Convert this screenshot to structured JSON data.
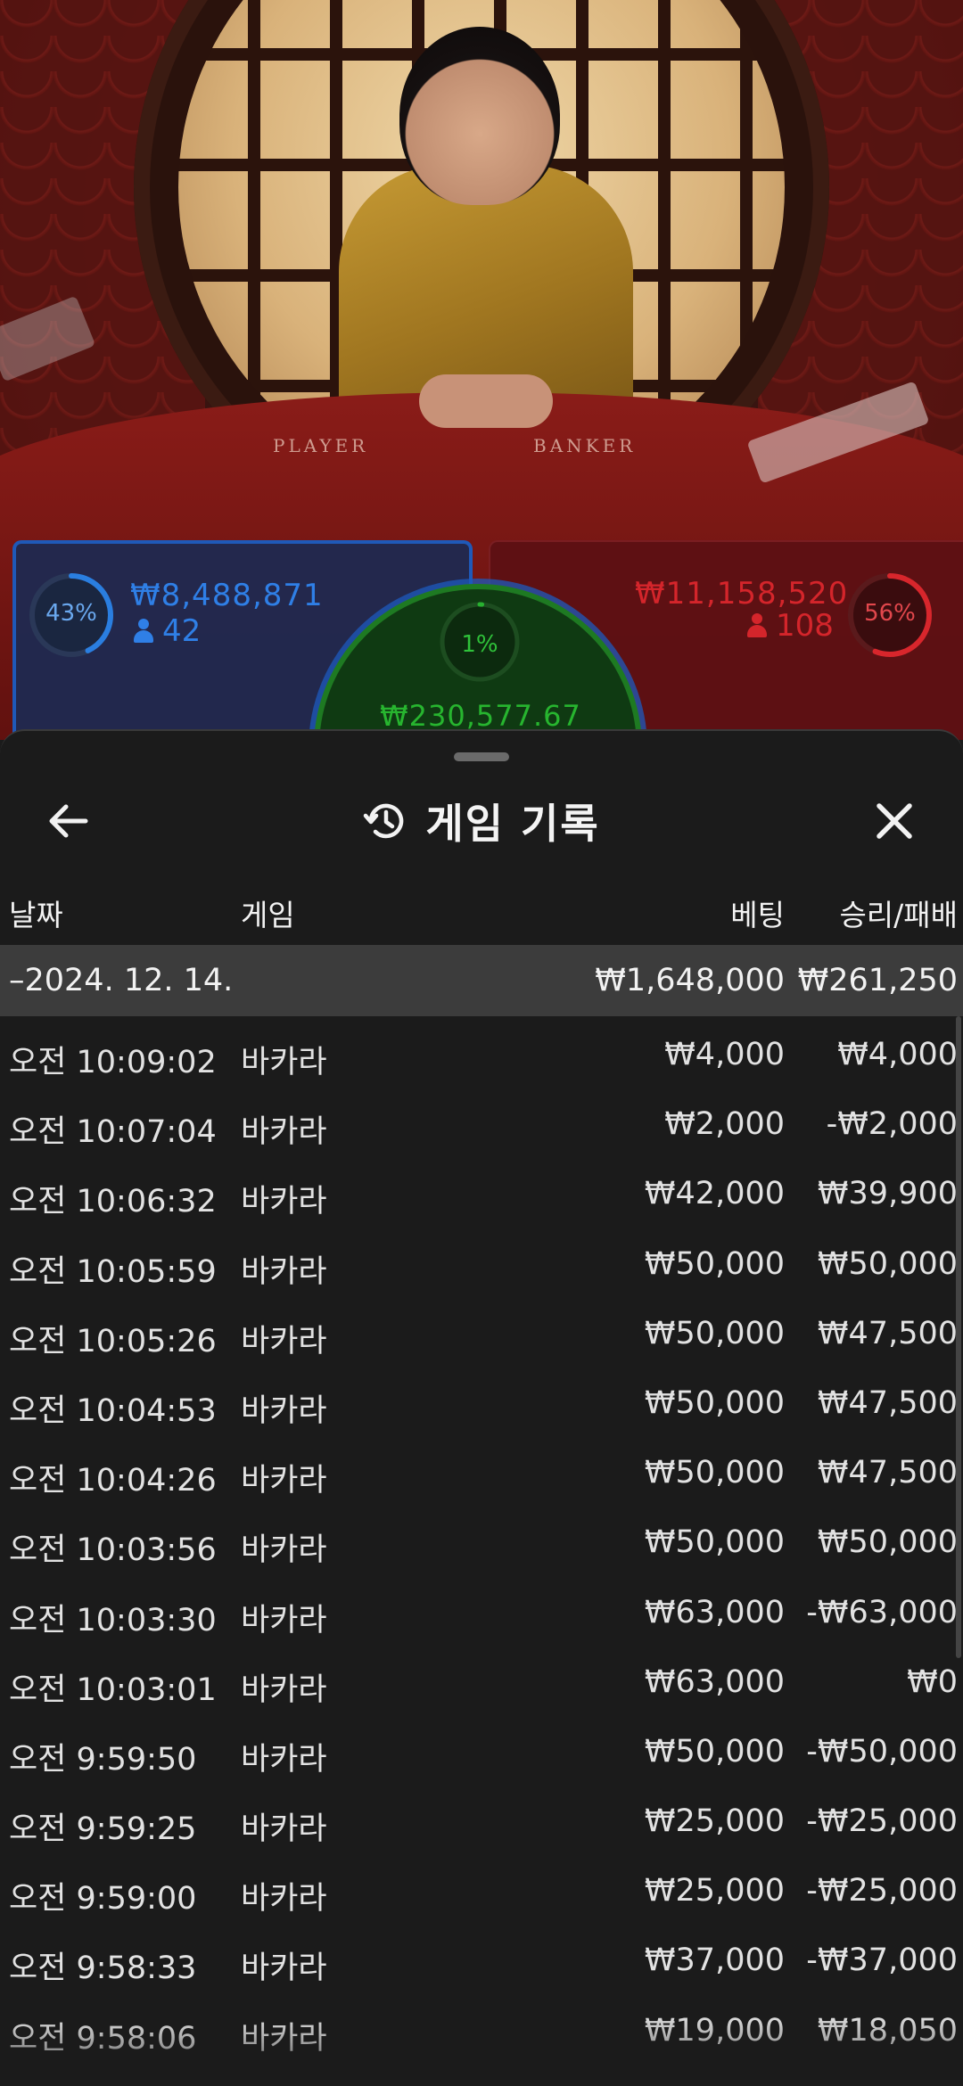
{
  "table": {
    "player_label": "PLAYER",
    "banker_label": "BANKER"
  },
  "stats": {
    "player": {
      "percent_text": "43%",
      "percent": 43,
      "amount": "₩8,488,871",
      "users": "42",
      "color": "#2a7ee0"
    },
    "tie": {
      "percent_text": "1%",
      "percent": 1,
      "amount": "₩230,577.67",
      "color": "#28b030"
    },
    "banker": {
      "percent_text": "56%",
      "percent": 56,
      "amount": "₩11,158,520",
      "users": "108",
      "color": "#d8262c"
    }
  },
  "sheet": {
    "title": "게임 기록",
    "back_icon": "arrow-left-icon",
    "history_icon": "history-icon",
    "close_icon": "close-icon",
    "columns": {
      "date": "날짜",
      "game": "게임",
      "bet": "베팅",
      "result": "승리/패배"
    },
    "day": {
      "date": "–2024. 12. 14.",
      "total_bet": "₩1,648,000",
      "total_result": "₩261,250"
    },
    "rows": [
      {
        "time": "오전 10:09:02",
        "game": "바카라",
        "bet": "₩4,000",
        "result": "₩4,000"
      },
      {
        "time": "오전 10:07:04",
        "game": "바카라",
        "bet": "₩2,000",
        "result": "-₩2,000"
      },
      {
        "time": "오전 10:06:32",
        "game": "바카라",
        "bet": "₩42,000",
        "result": "₩39,900"
      },
      {
        "time": "오전 10:05:59",
        "game": "바카라",
        "bet": "₩50,000",
        "result": "₩50,000"
      },
      {
        "time": "오전 10:05:26",
        "game": "바카라",
        "bet": "₩50,000",
        "result": "₩47,500"
      },
      {
        "time": "오전 10:04:53",
        "game": "바카라",
        "bet": "₩50,000",
        "result": "₩47,500"
      },
      {
        "time": "오전 10:04:26",
        "game": "바카라",
        "bet": "₩50,000",
        "result": "₩47,500"
      },
      {
        "time": "오전 10:03:56",
        "game": "바카라",
        "bet": "₩50,000",
        "result": "₩50,000"
      },
      {
        "time": "오전 10:03:30",
        "game": "바카라",
        "bet": "₩63,000",
        "result": "-₩63,000"
      },
      {
        "time": "오전 10:03:01",
        "game": "바카라",
        "bet": "₩63,000",
        "result": "₩0"
      },
      {
        "time": "오전 9:59:50",
        "game": "바카라",
        "bet": "₩50,000",
        "result": "-₩50,000"
      },
      {
        "time": "오전 9:59:25",
        "game": "바카라",
        "bet": "₩25,000",
        "result": "-₩25,000"
      },
      {
        "time": "오전 9:59:00",
        "game": "바카라",
        "bet": "₩25,000",
        "result": "-₩25,000"
      },
      {
        "time": "오전 9:58:33",
        "game": "바카라",
        "bet": "₩37,000",
        "result": "-₩37,000"
      },
      {
        "time": "오전 9:58:06",
        "game": "바카라",
        "bet": "₩19,000",
        "result": "₩18,050"
      }
    ]
  }
}
